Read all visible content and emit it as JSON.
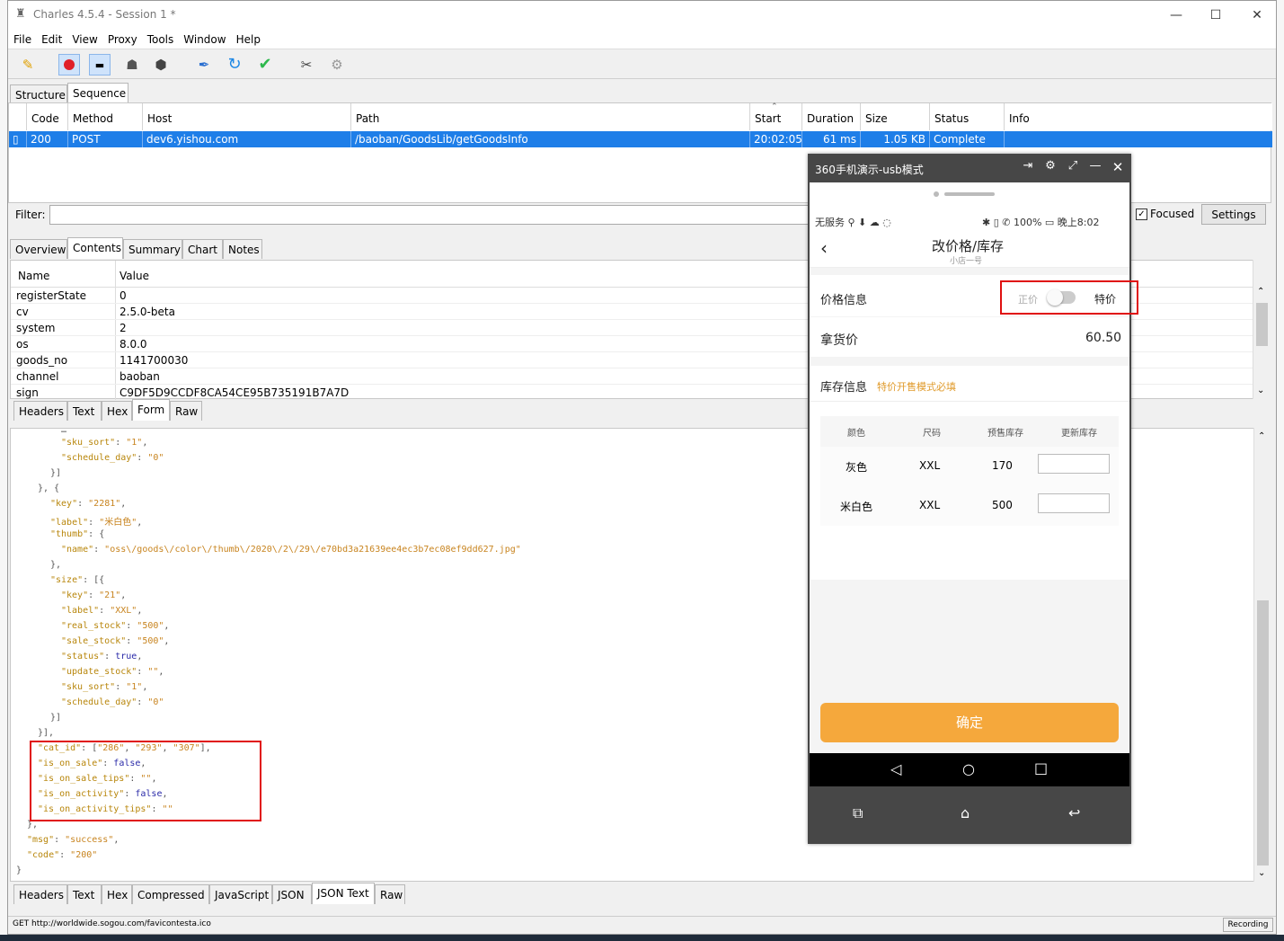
{
  "window": {
    "title": "Charles 4.5.4 - Session 1 *",
    "controls": [
      "—",
      "☐",
      "✕"
    ]
  },
  "menu": [
    "File",
    "Edit",
    "View",
    "Proxy",
    "Tools",
    "Window",
    "Help"
  ],
  "view_tabs": [
    "Structure",
    "Sequence"
  ],
  "sequence": {
    "columns": [
      "Code",
      "Method",
      "Host",
      "Path",
      "Start",
      "Duration",
      "Size",
      "Status",
      "Info"
    ],
    "row": {
      "code": "200",
      "method": "POST",
      "host": "dev6.yishou.com",
      "path": "/baoban/GoodsLib/getGoodsInfo",
      "start": "20:02:05",
      "duration": "61 ms",
      "size": "1.05 KB",
      "status": "Complete",
      "info": ""
    }
  },
  "filter": {
    "label": "Filter:",
    "focused_label": "Focused",
    "settings_label": "Settings"
  },
  "detail_tabs": [
    "Overview",
    "Contents",
    "Summary",
    "Chart",
    "Notes"
  ],
  "request_form": {
    "headers": [
      "Name",
      "Value"
    ],
    "rows": [
      {
        "name": "registerState",
        "value": "0"
      },
      {
        "name": "cv",
        "value": "2.5.0-beta"
      },
      {
        "name": "system",
        "value": "2"
      },
      {
        "name": "os",
        "value": "8.0.0"
      },
      {
        "name": "goods_no",
        "value": "1141700030"
      },
      {
        "name": "channel",
        "value": "baoban"
      },
      {
        "name": "sign",
        "value": "C9DF5D9CCDF8CA54CE95B735191B7A7D"
      }
    ]
  },
  "request_tabs": [
    "Headers",
    "Text",
    "Hex",
    "Form",
    "Raw"
  ],
  "response_tabs": [
    "Headers",
    "Text",
    "Hex",
    "Compressed",
    "JavaScript",
    "JSON",
    "JSON Text",
    "Raw"
  ],
  "json_lines": [
    "\"sku_sort\": \"1\",",
    "\"schedule_day\": \"0\"",
    "}]",
    "}, {",
    "\"key\": \"2281\",",
    "\"label\": \"米白色\",",
    "\"thumb\": {",
    "\"name\": \"oss\\/goods\\/color\\/thumb\\/2020\\/2\\/29\\/e70bd3a21639ee4ec3b7ec08ef9dd627.jpg\"",
    "},",
    "\"size\": [{",
    "\"key\": \"21\",",
    "\"label\": \"XXL\",",
    "\"real_stock\": \"500\",",
    "\"sale_stock\": \"500\",",
    "\"status\": true,",
    "\"update_stock\": \"\",",
    "\"sku_sort\": \"1\",",
    "\"schedule_day\": \"0\"",
    "}]",
    "}],",
    "\"cat_id\": [\"286\", \"293\", \"307\"],",
    "\"is_on_sale\": false,",
    "\"is_on_sale_tips\": \"\",",
    "\"is_on_activity\": false,",
    "\"is_on_activity_tips\": \"\"",
    "},",
    "\"msg\": \"success\",",
    "\"code\": \"200\"",
    "}"
  ],
  "statusbar": {
    "left": "GET http://worldwide.sogou.com/favicontesta.ico",
    "right": "Recording"
  },
  "phone": {
    "window_title": "360手机演示-usb模式",
    "status_left": "无服务 ⚲ ⬇ ☁ ◌",
    "status_right": "✱ ▯ ✆ 100% ▭ 晚上8:02",
    "page_title": "改价格/库存",
    "page_subtitle": "小店一号",
    "price_section_label": "价格信息",
    "toggle_left": "正价",
    "toggle_right": "特价",
    "purchase_price_label": "拿货价",
    "purchase_price_value": "60.50",
    "stock_section_label": "库存信息",
    "stock_hint": "特价开售模式必填",
    "stock_headers": [
      "颜色",
      "尺码",
      "预售库存",
      "更新库存"
    ],
    "stock_rows": [
      {
        "color": "灰色",
        "size": "XXL",
        "stock": "170"
      },
      {
        "color": "米白色",
        "size": "XXL",
        "stock": "500"
      }
    ],
    "confirm_label": "确定",
    "brand_color": "#f5a83c"
  }
}
